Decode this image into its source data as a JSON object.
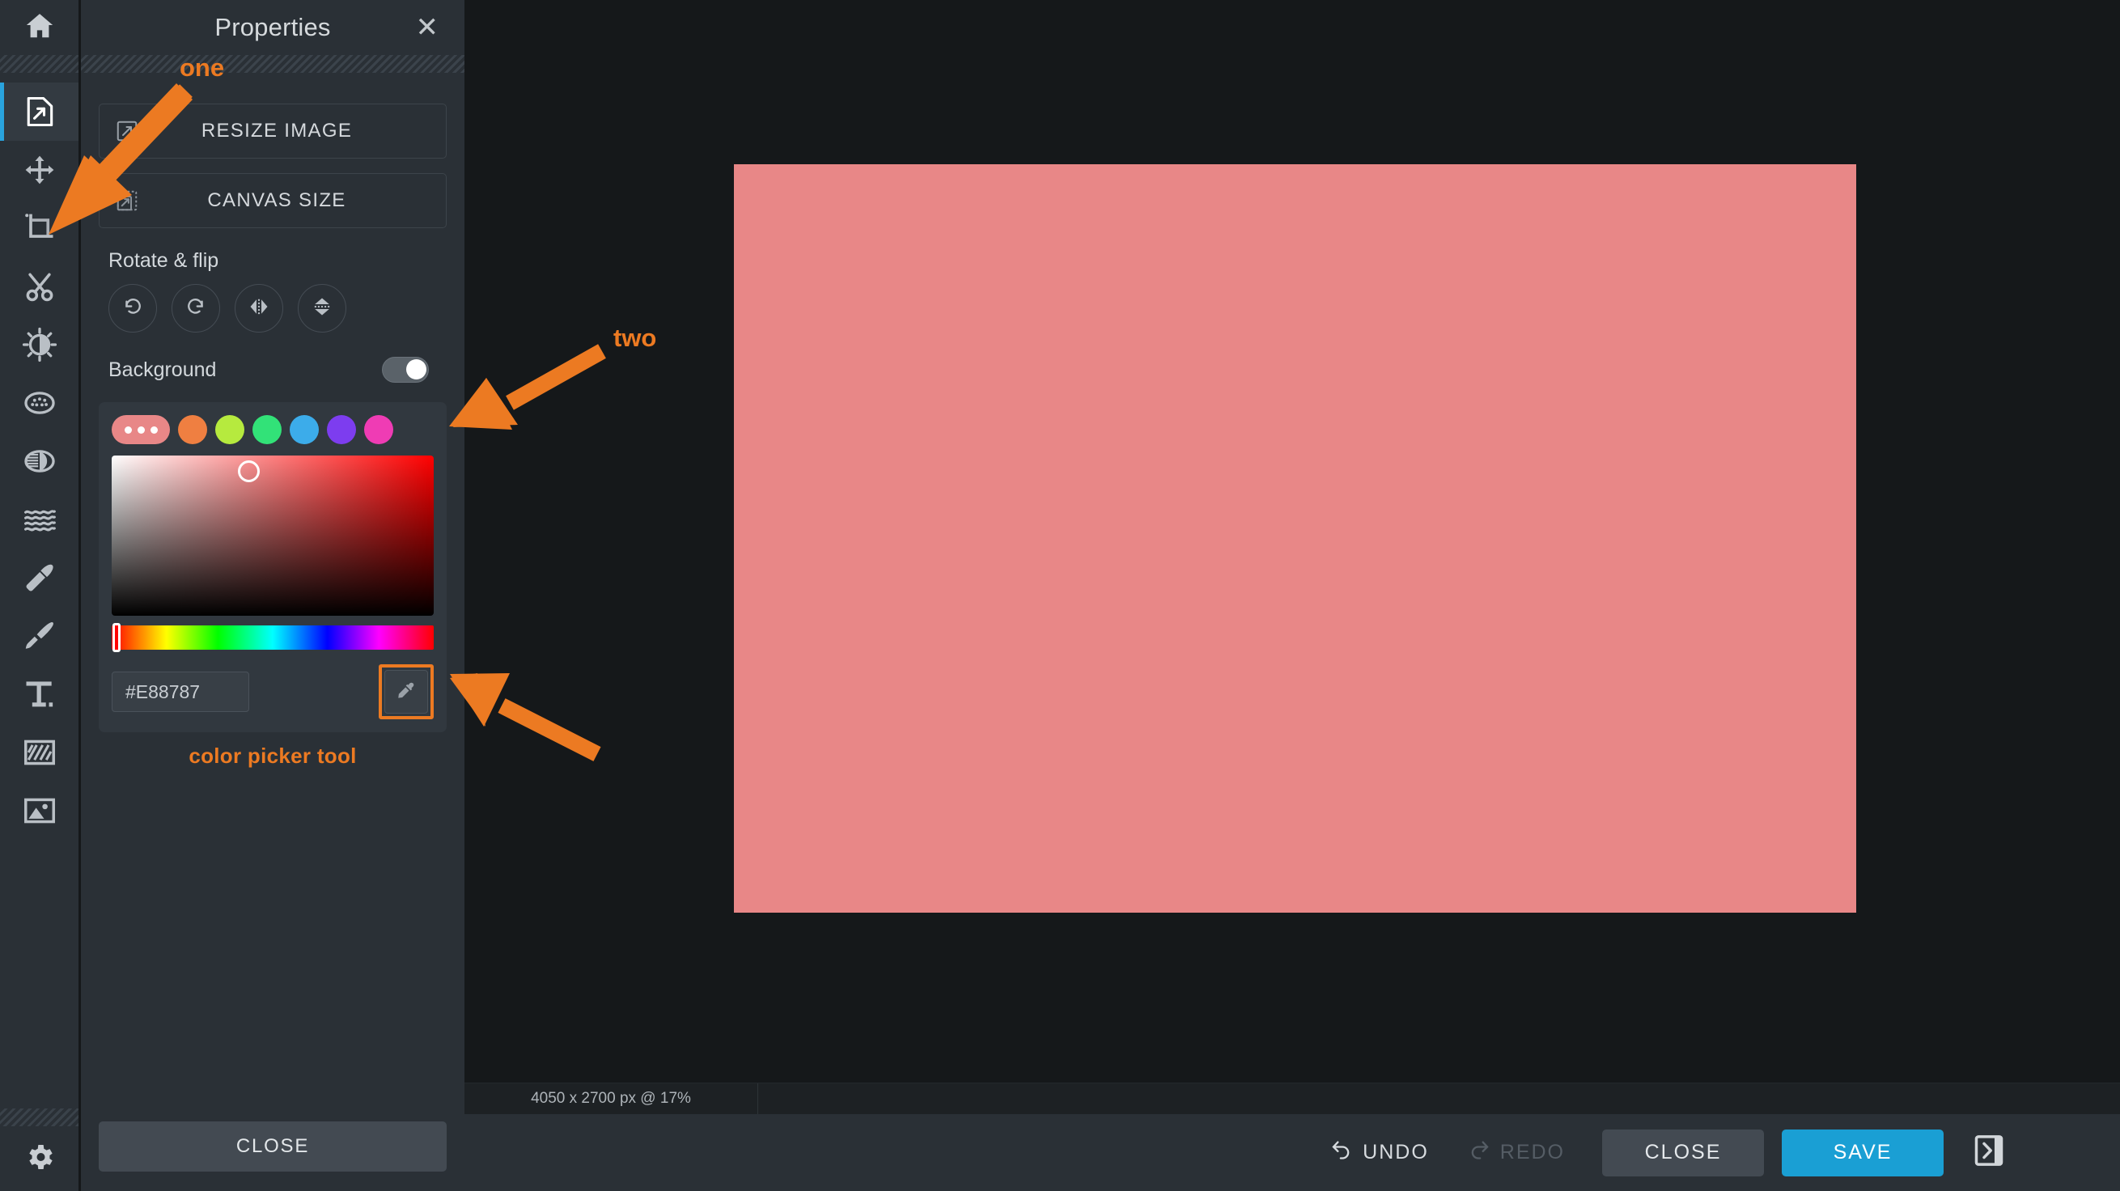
{
  "app": {
    "accent_blue": "#1a9fd4",
    "annotation_color": "#ec7a22",
    "panel_bg": "#2a3036",
    "canvas_bg": "#15181a"
  },
  "toolbar": {
    "home_icon": "home-icon",
    "gear_icon": "gear-icon",
    "tools": [
      {
        "name": "resize-tool",
        "icon": "document-resize-icon",
        "active": true
      },
      {
        "name": "move-tool",
        "icon": "move-arrows-icon",
        "active": false
      },
      {
        "name": "crop-tool",
        "icon": "crop-icon",
        "active": false
      },
      {
        "name": "cut-tool",
        "icon": "scissors-icon",
        "active": false
      },
      {
        "name": "brightness-tool",
        "icon": "brightness-sun-icon",
        "active": false
      },
      {
        "name": "noise-tool",
        "icon": "noise-dots-icon",
        "active": false
      },
      {
        "name": "contrast-tool",
        "icon": "contrast-half-icon",
        "active": false
      },
      {
        "name": "blur-tool",
        "icon": "waves-blur-icon",
        "active": false
      },
      {
        "name": "retouch-tool",
        "icon": "makeup-brush-icon",
        "active": false
      },
      {
        "name": "paint-tool",
        "icon": "paint-brush-icon",
        "active": false
      },
      {
        "name": "text-tool",
        "icon": "text-t-icon",
        "active": false
      },
      {
        "name": "pattern-tool",
        "icon": "hatch-square-icon",
        "active": false
      },
      {
        "name": "image-tool",
        "icon": "picture-icon",
        "active": false
      }
    ]
  },
  "panel": {
    "title": "Properties",
    "close_icon": "✕",
    "resize_image_label": "RESIZE IMAGE",
    "canvas_size_label": "CANVAS SIZE",
    "rotate_section_title": "Rotate & flip",
    "rotate_buttons": [
      {
        "name": "rotate-left-button",
        "icon": "rotate-ccw-icon"
      },
      {
        "name": "rotate-right-button",
        "icon": "rotate-cw-icon"
      },
      {
        "name": "flip-horizontal-button",
        "icon": "flip-horizontal-icon"
      },
      {
        "name": "flip-vertical-button",
        "icon": "flip-vertical-icon"
      }
    ],
    "background_label": "Background",
    "background_enabled": true,
    "swatches": [
      {
        "name": "current-color-swatch",
        "color": "#e88787",
        "current": true
      },
      {
        "name": "swatch-orange",
        "color": "#ef7f41",
        "current": false
      },
      {
        "name": "swatch-lime",
        "color": "#b6ea3e",
        "current": false
      },
      {
        "name": "swatch-green",
        "color": "#32e278",
        "current": false
      },
      {
        "name": "swatch-blue",
        "color": "#3cacea",
        "current": false
      },
      {
        "name": "swatch-purple",
        "color": "#7d3def",
        "current": false
      },
      {
        "name": "swatch-pink",
        "color": "#ef3cb4",
        "current": false
      }
    ],
    "hex_value": "#E88787",
    "hex_placeholder": "#E88787",
    "eyedropper_icon": "eyedropper-icon",
    "close_button_label": "CLOSE"
  },
  "canvas": {
    "fill_color": "#e88787",
    "status_text": "4050 x 2700 px @ 17%"
  },
  "actions": {
    "undo_label": "UNDO",
    "undo_icon": "undo-arrow-icon",
    "redo_label": "REDO",
    "redo_icon": "redo-arrow-icon",
    "redo_disabled": true,
    "close_label": "CLOSE",
    "save_label": "SAVE",
    "expand_icon": "panel-expand-icon"
  },
  "annotations": [
    {
      "name": "annotation-one",
      "label": "one"
    },
    {
      "name": "annotation-two",
      "label": "two"
    },
    {
      "name": "annotation-color-picker-tool",
      "label": "color picker tool"
    }
  ]
}
